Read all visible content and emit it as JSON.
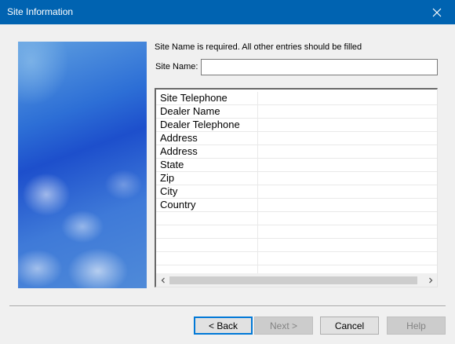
{
  "window": {
    "title": "Site Information",
    "close_icon": "close-icon",
    "titlebar_color": "#0063b1"
  },
  "form": {
    "instruction": "Site Name is required. All other entries should be filled",
    "site_name_label": "Site Name:",
    "site_name_value": ""
  },
  "grid": {
    "rows": [
      {
        "name": "Site Telephone",
        "value": ""
      },
      {
        "name": "Dealer Name",
        "value": ""
      },
      {
        "name": "Dealer Telephone",
        "value": ""
      },
      {
        "name": "Address",
        "value": ""
      },
      {
        "name": "Address",
        "value": ""
      },
      {
        "name": "State",
        "value": ""
      },
      {
        "name": "Zip",
        "value": ""
      },
      {
        "name": "City",
        "value": ""
      },
      {
        "name": "Country",
        "value": ""
      },
      {
        "name": "",
        "value": ""
      },
      {
        "name": "",
        "value": ""
      },
      {
        "name": "",
        "value": ""
      },
      {
        "name": "",
        "value": ""
      },
      {
        "name": "",
        "value": ""
      }
    ],
    "scroll_left_icon": "chevron-left-icon",
    "scroll_right_icon": "chevron-right-icon"
  },
  "buttons": {
    "back": "< Back",
    "next": "Next >",
    "cancel": "Cancel",
    "help": "Help"
  }
}
